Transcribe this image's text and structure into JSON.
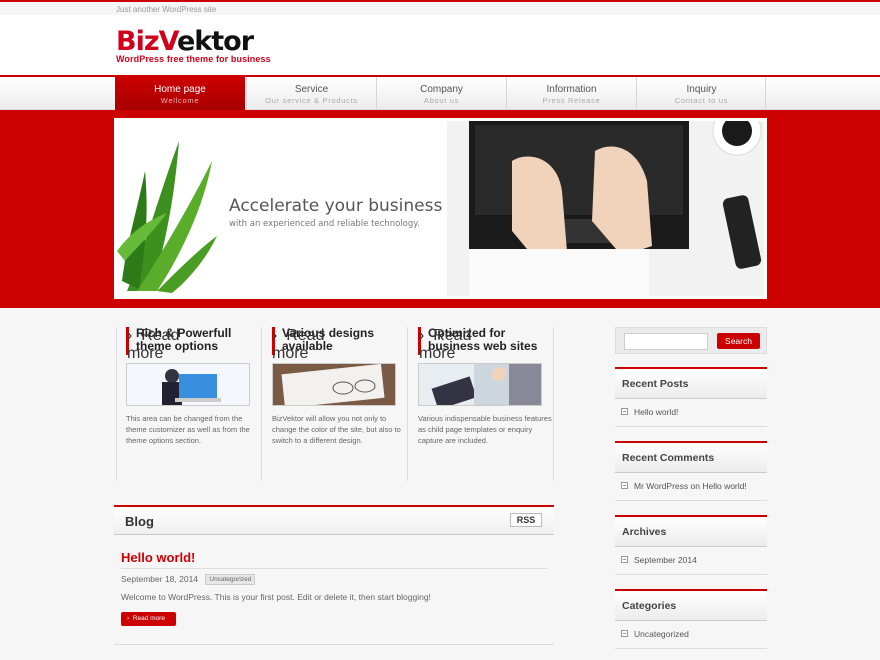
{
  "site": {
    "tagline": "Just another WordPress site",
    "logo_main": "BizVektor",
    "logo_sub": "WordPress free theme for business"
  },
  "nav": [
    {
      "label": "Home page",
      "sub": "Wellcome"
    },
    {
      "label": "Service",
      "sub": "Our service & Products"
    },
    {
      "label": "Company",
      "sub": "About us"
    },
    {
      "label": "Information",
      "sub": "Press Release"
    },
    {
      "label": "Inquiry",
      "sub": "Contact to us"
    }
  ],
  "hero": {
    "title": "Accelerate your business",
    "subtitle": "with an experienced and reliable technology."
  },
  "features": [
    {
      "title": "Rich & Powerfull theme options",
      "text": "This area can be changed from the theme customizer as well as from the theme options section.",
      "button": "Read more"
    },
    {
      "title": "Various designs available",
      "text": "BizVektor will allow you not only to change the color of the site, but also to switch to a different design.",
      "button": "Read more"
    },
    {
      "title": "Optimized for business web sites",
      "text": "Various indispensable business features as child page templates or enquiry capture are included.",
      "button": "Read more"
    }
  ],
  "blog": {
    "heading": "Blog",
    "rss": "RSS",
    "post": {
      "title": "Hello world!",
      "date": "September 18, 2014",
      "category": "Uncategorized",
      "excerpt": "Welcome to WordPress. This is your first post. Edit or delete it, then start blogging!",
      "button": "Read more"
    }
  },
  "sidebar": {
    "search_button": "Search",
    "widgets": [
      {
        "title": "Recent Posts",
        "item": "Hello world!"
      },
      {
        "title": "Recent Comments",
        "item": "Mr WordPress on Hello world!"
      },
      {
        "title": "Archives",
        "item": "September 2014"
      },
      {
        "title": "Categories",
        "item": "Uncategorized"
      }
    ]
  },
  "colors": {
    "accent": "#cc0000",
    "background": "#f6f6f6"
  }
}
